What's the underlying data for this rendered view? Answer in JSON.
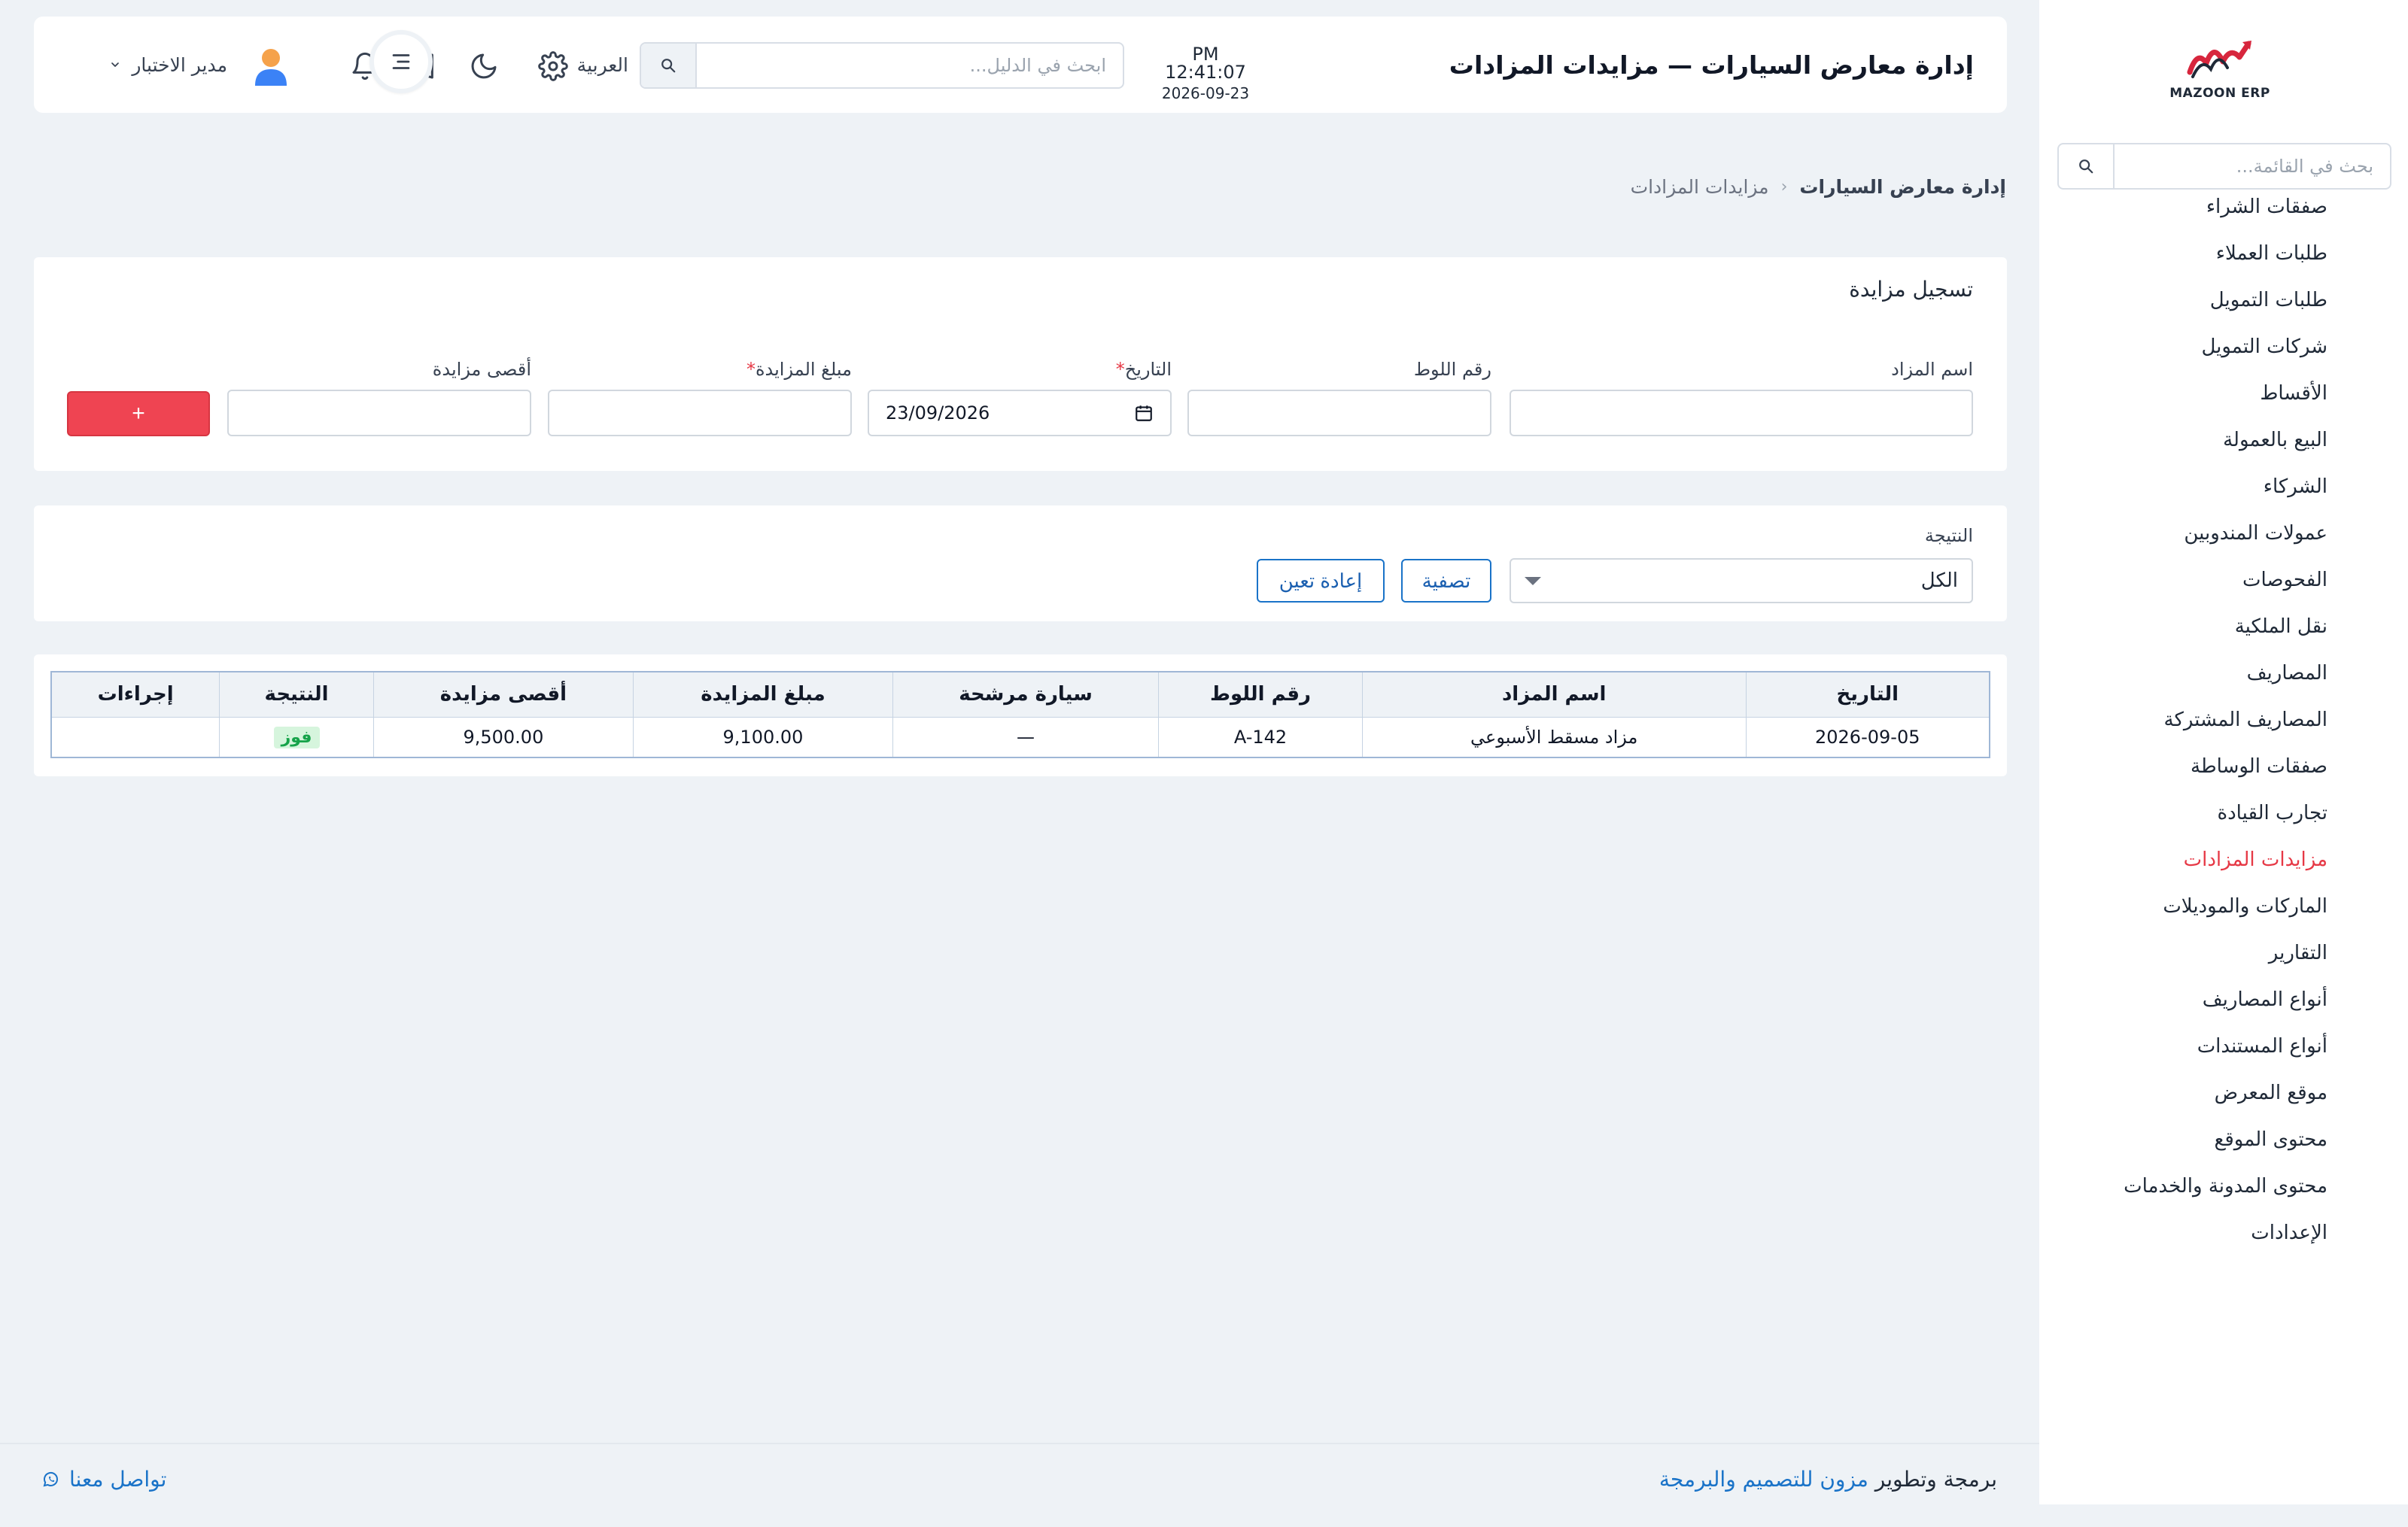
{
  "header": {
    "title": "إدارة معارض السيارات — مزايدات المزادات",
    "clock_time": "PM 12:41:07",
    "clock_date": "2026-09-23",
    "search_placeholder": "ابحث في الدليل...",
    "language": "العربية",
    "user_name": "مدير الاختبار"
  },
  "sidebar": {
    "logo_text": "MAZOON ERP",
    "search_placeholder": "بحث في القائمة...",
    "items": [
      {
        "label": "صفقات الشراء"
      },
      {
        "label": "طلبات العملاء"
      },
      {
        "label": "طلبات التمويل"
      },
      {
        "label": "شركات التمويل"
      },
      {
        "label": "الأقساط"
      },
      {
        "label": "البيع بالعمولة"
      },
      {
        "label": "الشركاء"
      },
      {
        "label": "عمولات المندوبين"
      },
      {
        "label": "الفحوصات"
      },
      {
        "label": "نقل الملكية"
      },
      {
        "label": "المصاريف"
      },
      {
        "label": "المصاريف المشتركة"
      },
      {
        "label": "صفقات الوساطة"
      },
      {
        "label": "تجارب القيادة"
      },
      {
        "label": "مزايدات المزادات",
        "active": true
      },
      {
        "label": "الماركات والموديلات"
      },
      {
        "label": "التقارير"
      },
      {
        "label": "أنواع المصاريف"
      },
      {
        "label": "أنواع المستندات"
      },
      {
        "label": "موقع المعرض"
      },
      {
        "label": "محتوى الموقع"
      },
      {
        "label": "محتوى المدونة والخدمات"
      },
      {
        "label": "الإعدادات"
      }
    ]
  },
  "breadcrumb": {
    "parent": "إدارة معارض السيارات",
    "current": "مزايدات المزادات"
  },
  "form": {
    "title": "تسجيل مزايدة",
    "auction_name_label": "اسم المزاد",
    "lot_number_label": "رقم اللوط",
    "date_label": "التاريخ",
    "date_value": "23/09/2026",
    "bid_amount_label": "مبلغ المزايدة",
    "max_bid_label": "أقصى مزايدة",
    "required_mark": "*",
    "add_button": "+"
  },
  "filter": {
    "result_label": "النتيجة",
    "result_value": "الكل",
    "apply_button": "تصفية",
    "reset_button": "إعادة تعين"
  },
  "table": {
    "columns": [
      "التاريخ",
      "اسم المزاد",
      "رقم اللوط",
      "سيارة مرشحة",
      "مبلغ المزايدة",
      "أقصى مزايدة",
      "النتيجة",
      "إجراءات"
    ],
    "rows": [
      {
        "date": "2026-09-05",
        "auction": "مزاد مسقط الأسبوعي",
        "lot": "A-142",
        "car": "—",
        "bid": "9,100.00",
        "max_bid": "9,500.00",
        "result": "فوز",
        "actions": ""
      }
    ]
  },
  "footer": {
    "credit_prefix": "برمجة وتطوير",
    "credit_link": "مزون للتصميم والبرمجة",
    "contact": "تواصل معنا"
  },
  "colors": {
    "accent_red": "#ef4452",
    "link_blue": "#1a73c8",
    "success_green": "#16a34a",
    "page_bg": "#eef2f6"
  }
}
